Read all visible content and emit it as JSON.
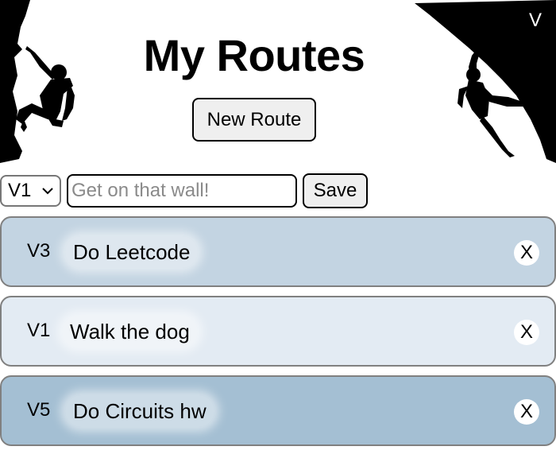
{
  "header": {
    "title": "My Routes",
    "corner_text": "V",
    "new_route_label": "New Route"
  },
  "form": {
    "grade_selected": "V1",
    "input_placeholder": "Get on that wall!",
    "input_value": "",
    "save_label": "Save"
  },
  "routes": [
    {
      "grade": "V3",
      "name": "Do Leetcode",
      "color": "#c3d4e2",
      "delete_label": "X"
    },
    {
      "grade": "V1",
      "name": "Walk the dog",
      "color": "#e3ebf3",
      "delete_label": "X"
    },
    {
      "grade": "V5",
      "name": "Do Circuits hw",
      "color": "#a4bfd3",
      "delete_label": "X"
    }
  ],
  "icons": {
    "left_decoration": "climber-silhouette-left",
    "right_decoration": "climber-silhouette-right",
    "select_arrow": "chevron-down-icon"
  }
}
